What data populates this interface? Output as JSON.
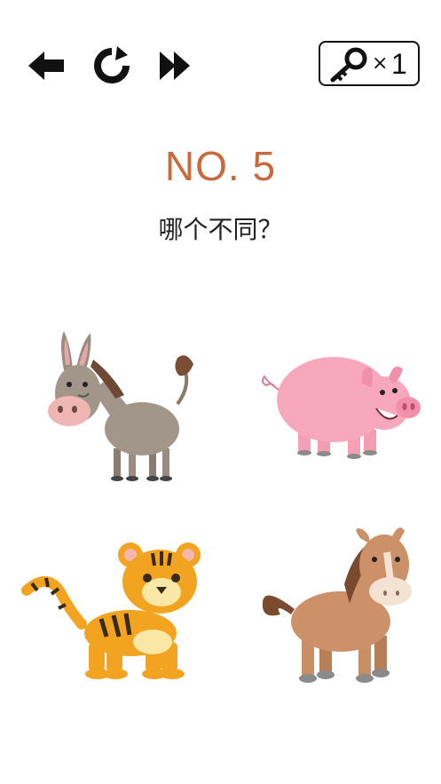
{
  "toolbar": {
    "back_icon": "arrow-left-icon",
    "restart_icon": "restart-icon",
    "skip_icon": "fast-forward-icon",
    "key_icon": "key-icon",
    "key_multiplier": "×",
    "key_count": "1"
  },
  "level": {
    "label": "NO. 5"
  },
  "question": {
    "text": "哪个不同？"
  },
  "options": [
    {
      "animal": "donkey"
    },
    {
      "animal": "pig"
    },
    {
      "animal": "tiger"
    },
    {
      "animal": "horse"
    }
  ],
  "colors": {
    "level_text": "#c76a3c",
    "icon": "#111111",
    "background": "#ffffff"
  }
}
